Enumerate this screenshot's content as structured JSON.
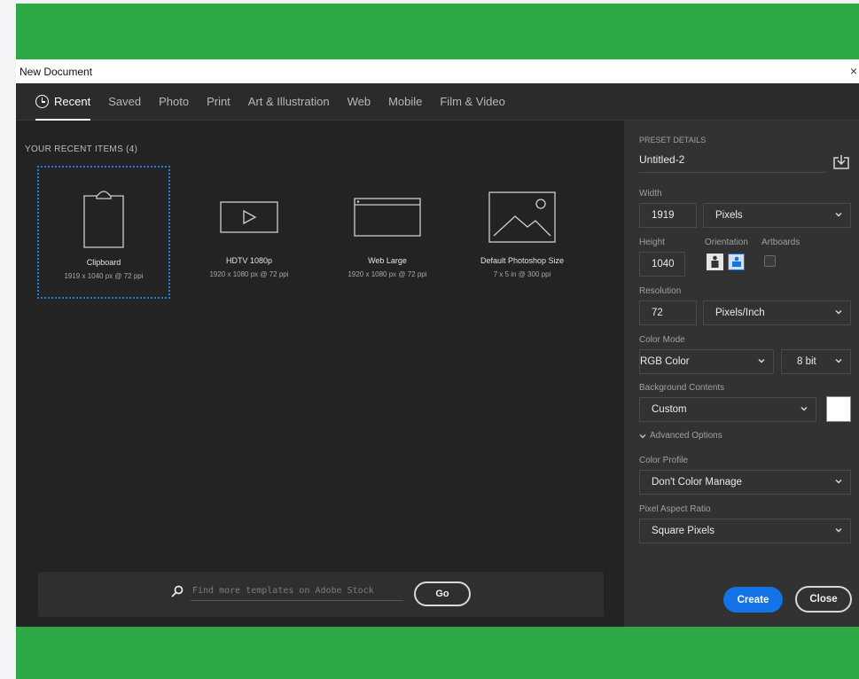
{
  "window": {
    "title": "New Document",
    "close_label": "×"
  },
  "tabs": [
    {
      "label": "Recent",
      "active": true
    },
    {
      "label": "Saved"
    },
    {
      "label": "Photo"
    },
    {
      "label": "Print"
    },
    {
      "label": "Art & Illustration"
    },
    {
      "label": "Web"
    },
    {
      "label": "Mobile"
    },
    {
      "label": "Film & Video"
    }
  ],
  "recent": {
    "title": "YOUR RECENT ITEMS  (4)",
    "items": [
      {
        "name": "Clipboard",
        "meta": "1919 x 1040 px @ 72 ppi",
        "icon": "clipboard-icon",
        "selected": true
      },
      {
        "name": "HDTV 1080p",
        "meta": "1920 x 1080 px @ 72 ppi",
        "icon": "video-icon"
      },
      {
        "name": "Web Large",
        "meta": "1920 x 1080 px @ 72 ppi",
        "icon": "browser-icon"
      },
      {
        "name": "Default Photoshop Size",
        "meta": "7 x 5 in @ 300 ppi",
        "icon": "image-icon"
      }
    ]
  },
  "stock": {
    "placeholder": "Find more templates on Adobe Stock",
    "go_label": "Go"
  },
  "preset": {
    "section_label": "PRESET DETAILS",
    "name": "Untitled-2",
    "width_label": "Width",
    "width_value": "1919",
    "width_unit": "Pixels",
    "height_label": "Height",
    "height_value": "1040",
    "orientation_label": "Orientation",
    "artboards_label": "Artboards",
    "resolution_label": "Resolution",
    "resolution_value": "72",
    "resolution_unit": "Pixels/Inch",
    "color_mode_label": "Color Mode",
    "color_mode": "RGB Color",
    "bit_depth": "8 bit",
    "bg_label": "Background Contents",
    "bg_value": "Custom",
    "bg_color": "#ffffff",
    "advanced_label": "Advanced Options",
    "color_profile_label": "Color Profile",
    "color_profile": "Don't Color Manage",
    "pixel_aspect_label": "Pixel Aspect Ratio",
    "pixel_aspect": "Square Pixels"
  },
  "buttons": {
    "create": "Create",
    "close": "Close"
  },
  "colors": {
    "accent": "#1473e6",
    "selection": "#1e7fe0",
    "background_band": "#2ea844"
  }
}
